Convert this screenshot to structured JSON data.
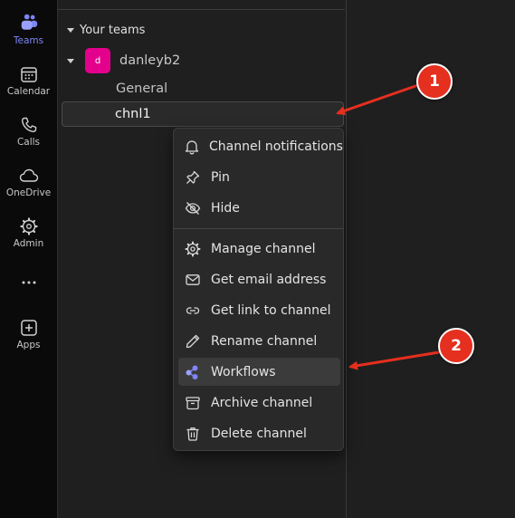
{
  "rail": {
    "items": [
      {
        "label": "Teams",
        "icon": "teams-icon",
        "active": true
      },
      {
        "label": "Calendar",
        "icon": "calendar-icon"
      },
      {
        "label": "Calls",
        "icon": "phone-icon"
      },
      {
        "label": "OneDrive",
        "icon": "cloud-icon"
      },
      {
        "label": "Admin",
        "icon": "admin-gear-icon"
      },
      {
        "label": "",
        "icon": "more-icon"
      },
      {
        "label": "Apps",
        "icon": "add-app-icon"
      }
    ]
  },
  "panel": {
    "section_title": "Your teams",
    "team": {
      "avatar_letter": "d",
      "name": "danleyb2",
      "avatar_color": "#e3008c"
    },
    "channels": [
      "General",
      "chnl1"
    ]
  },
  "menu": {
    "items": [
      {
        "label": "Channel notifications",
        "icon": "bell-icon"
      },
      {
        "label": "Pin",
        "icon": "pin-icon"
      },
      {
        "label": "Hide",
        "icon": "hide-eye-icon"
      },
      {
        "label": "Manage channel",
        "icon": "gear-icon"
      },
      {
        "label": "Get email address",
        "icon": "mail-icon"
      },
      {
        "label": "Get link to channel",
        "icon": "link-icon"
      },
      {
        "label": "Rename channel",
        "icon": "pencil-icon"
      },
      {
        "label": "Workflows",
        "icon": "workflows-icon",
        "highlighted": true
      },
      {
        "label": "Archive channel",
        "icon": "archive-icon"
      },
      {
        "label": "Delete channel",
        "icon": "trash-icon"
      }
    ]
  },
  "annotations": {
    "badges": [
      "1",
      "2"
    ],
    "color": "#e52f1f"
  }
}
